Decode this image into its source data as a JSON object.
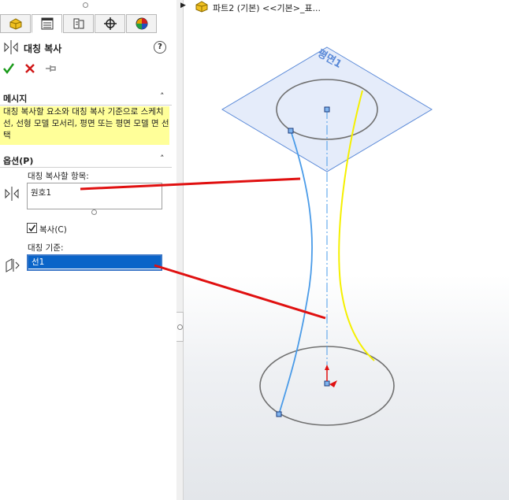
{
  "breadcrumb": {
    "text": "파트2 (기본) <<기본>_표..."
  },
  "tabs": [
    {
      "icon": "feature-manager-icon"
    },
    {
      "icon": "property-manager-icon"
    },
    {
      "icon": "configuration-manager-icon"
    },
    {
      "icon": "dimxpert-icon"
    },
    {
      "icon": "display-manager-icon"
    }
  ],
  "property_manager": {
    "title": "대칭 복사",
    "help": "?",
    "message_section": {
      "header": "메시지",
      "text": "대칭 복사할 요소와 대칭 복사 기준으로 스케치 선, 선형 모델 모서리, 평면 또는 평면 모델 면 선택"
    },
    "options_section": {
      "header": "옵션(P)",
      "entities_label": "대칭 복사할 항목:",
      "entities_item": "원호1",
      "copy_label": "복사(C)",
      "copy_checked": true,
      "mirror_about_label": "대칭 기준:",
      "mirror_about_item": "선1"
    }
  },
  "viewport": {
    "plane_label": "평면1"
  },
  "colors": {
    "selection_blue": "#0a64c8",
    "message_yellow": "#ffff99",
    "sketch_blue": "#4a9be8",
    "highlight_yellow": "#f5f000",
    "annotation_red": "#e01010"
  }
}
